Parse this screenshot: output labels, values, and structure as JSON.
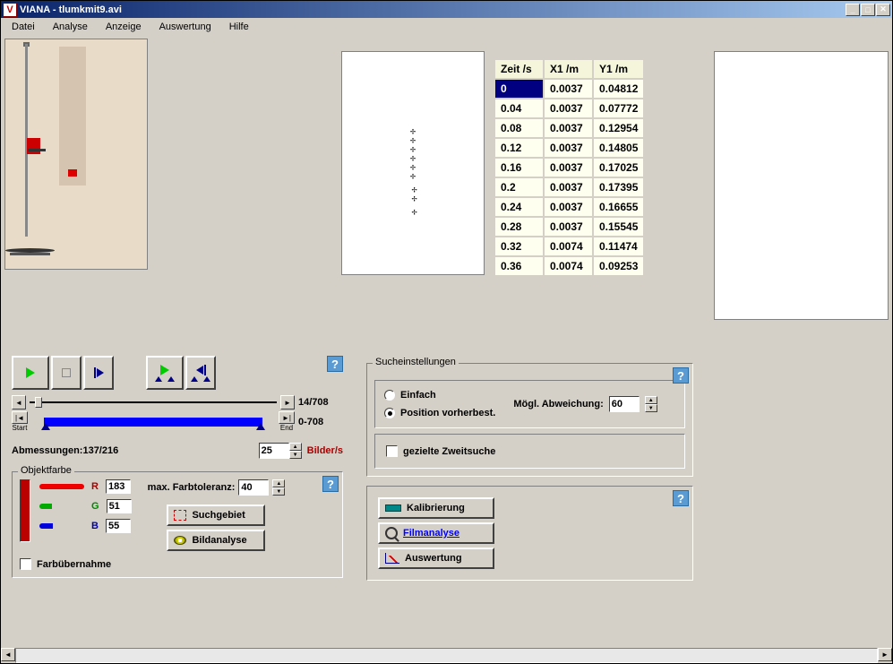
{
  "window": {
    "title": "VIANA - tlumkmit9.avi",
    "icon_letter": "V"
  },
  "menu": {
    "datei": "Datei",
    "analyse": "Analyse",
    "anzeige": "Anzeige",
    "auswertung": "Auswertung",
    "hilfe": "Hilfe"
  },
  "table": {
    "headers": {
      "zeit": "Zeit /s",
      "x1": "X1 /m",
      "y1": "Y1 /m"
    },
    "rows": [
      {
        "t": "0",
        "x": "0.0037",
        "y": "0.04812",
        "sel": true
      },
      {
        "t": "0.04",
        "x": "0.0037",
        "y": "0.07772"
      },
      {
        "t": "0.08",
        "x": "0.0037",
        "y": "0.12954"
      },
      {
        "t": "0.12",
        "x": "0.0037",
        "y": "0.14805"
      },
      {
        "t": "0.16",
        "x": "0.0037",
        "y": "0.17025"
      },
      {
        "t": "0.2",
        "x": "0.0037",
        "y": "0.17395"
      },
      {
        "t": "0.24",
        "x": "0.0037",
        "y": "0.16655"
      },
      {
        "t": "0.28",
        "x": "0.0037",
        "y": "0.15545"
      },
      {
        "t": "0.32",
        "x": "0.0074",
        "y": "0.11474"
      },
      {
        "t": "0.36",
        "x": "0.0074",
        "y": "0.09253"
      }
    ]
  },
  "playback": {
    "frame_label": "14/708",
    "range_label": "0-708",
    "start_label": "Start",
    "end_label": "End",
    "dimensions_label": "Abmessungen:137/216",
    "fps_value": "25",
    "fps_unit": "Bilder/s"
  },
  "objektfarbe": {
    "legend": "Objektfarbe",
    "r_label": "R",
    "g_label": "G",
    "b_label": "B",
    "r_value": "183",
    "g_value": "51",
    "b_value": "55",
    "farbubernahme": "Farbübernahme",
    "max_tol_label": "max. Farbtoleranz:",
    "max_tol_value": "40",
    "suchgebiet": "Suchgebiet",
    "bildanalyse": "Bildanalyse"
  },
  "sucheinstellungen": {
    "legend": "Sucheinstellungen",
    "einfach": "Einfach",
    "position_vorherbest": "Position vorherbest.",
    "abweichung_label": "Mögl. Abweichung:",
    "abweichung_value": "60",
    "zweitsuche": "gezielte Zweitsuche"
  },
  "actions": {
    "kalibrierung": "Kalibrierung",
    "filmanalyse": "Filmanalyse",
    "auswertung": "Auswertung"
  },
  "help_glyph": "?"
}
